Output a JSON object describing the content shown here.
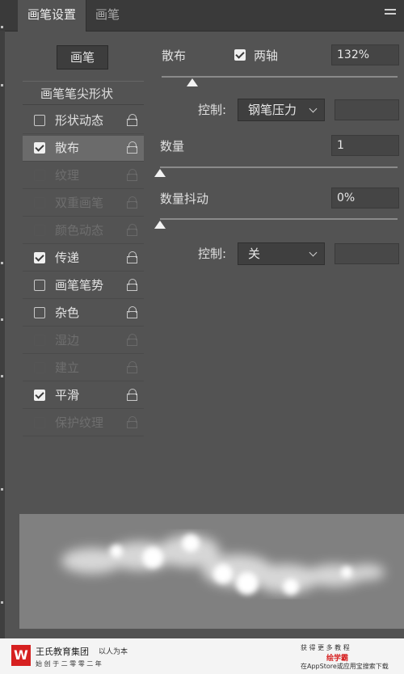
{
  "tabs": {
    "brush_settings": "画笔设置",
    "brush": "画笔"
  },
  "left": {
    "brush_button": "画笔",
    "tip_shape": "画笔笔尖形状",
    "options": [
      {
        "label": "形状动态",
        "checked": false,
        "selected": false,
        "enabled": true
      },
      {
        "label": "散布",
        "checked": true,
        "selected": true,
        "enabled": true
      },
      {
        "label": "纹理",
        "checked": false,
        "selected": false,
        "enabled": false
      },
      {
        "label": "双重画笔",
        "checked": false,
        "selected": false,
        "enabled": false
      },
      {
        "label": "颜色动态",
        "checked": false,
        "selected": false,
        "enabled": false
      },
      {
        "label": "传递",
        "checked": true,
        "selected": false,
        "enabled": true
      },
      {
        "label": "画笔笔势",
        "checked": false,
        "selected": false,
        "enabled": true
      },
      {
        "label": "杂色",
        "checked": false,
        "selected": false,
        "enabled": true
      },
      {
        "label": "湿边",
        "checked": false,
        "selected": false,
        "enabled": false
      },
      {
        "label": "建立",
        "checked": false,
        "selected": false,
        "enabled": false
      },
      {
        "label": "平滑",
        "checked": true,
        "selected": false,
        "enabled": true
      },
      {
        "label": "保护纹理",
        "checked": false,
        "selected": false,
        "enabled": false
      }
    ]
  },
  "right": {
    "scatter_label": "散布",
    "both_axes_label": "两轴",
    "both_axes_checked": true,
    "scatter_value": "132%",
    "scatter_level": 0.13,
    "control_label_1": "控制:",
    "control_select_1": "钢笔压力",
    "count_label": "数量",
    "count_value": "1",
    "count_level": 0.0,
    "count_jitter_label": "数量抖动",
    "count_jitter_value": "0%",
    "count_jitter_level": 0.0,
    "control_label_2": "控制:",
    "control_select_2": "关"
  },
  "footer": {
    "brand": "王氏教育集团",
    "brand_sub": "始 创 于 二 零 零 二 年",
    "slogan": "以人为本",
    "app_line_1": "获 得 更 多 教 程",
    "app_name": "绘学霸",
    "app_line_2": "在AppStore或应用宝搜索下载"
  },
  "colors": {
    "panel_bg": "#535353",
    "selected_row": "#6b6b6b",
    "brand_red": "#d62020"
  }
}
